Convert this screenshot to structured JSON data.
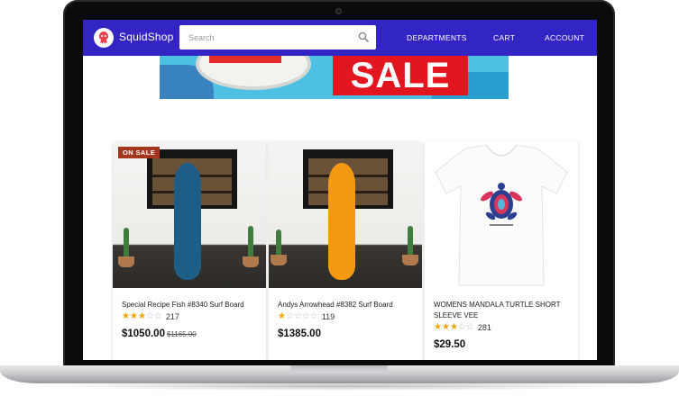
{
  "brand": {
    "name": "SquidShop"
  },
  "search": {
    "placeholder": "Search"
  },
  "nav": {
    "links": [
      "DEPARTMENTS",
      "CART",
      "ACCOUNT"
    ]
  },
  "banner": {
    "text": "SALE"
  },
  "products": [
    {
      "title": "Special Recipe Fish #8340 Surf Board",
      "rating": 3,
      "reviews": "217",
      "price": "$1050.00",
      "old_price": "$1165.00",
      "badge": "ON SALE",
      "board_color": "#1e5d86"
    },
    {
      "title": "Andys Arrowhead #8382 Surf Board",
      "rating": 1,
      "reviews": "119",
      "price": "$1385.00",
      "board_color": "#f39a12"
    },
    {
      "title": "WOMENS MANDALA TURTLE SHORT SLEEVE VEE",
      "rating": 3,
      "reviews": "281",
      "price": "$29.50"
    }
  ],
  "colors": {
    "navbar": "#3325c4",
    "star": "#f4a300",
    "badge": "#a3361c",
    "sale": "#e3161f"
  }
}
